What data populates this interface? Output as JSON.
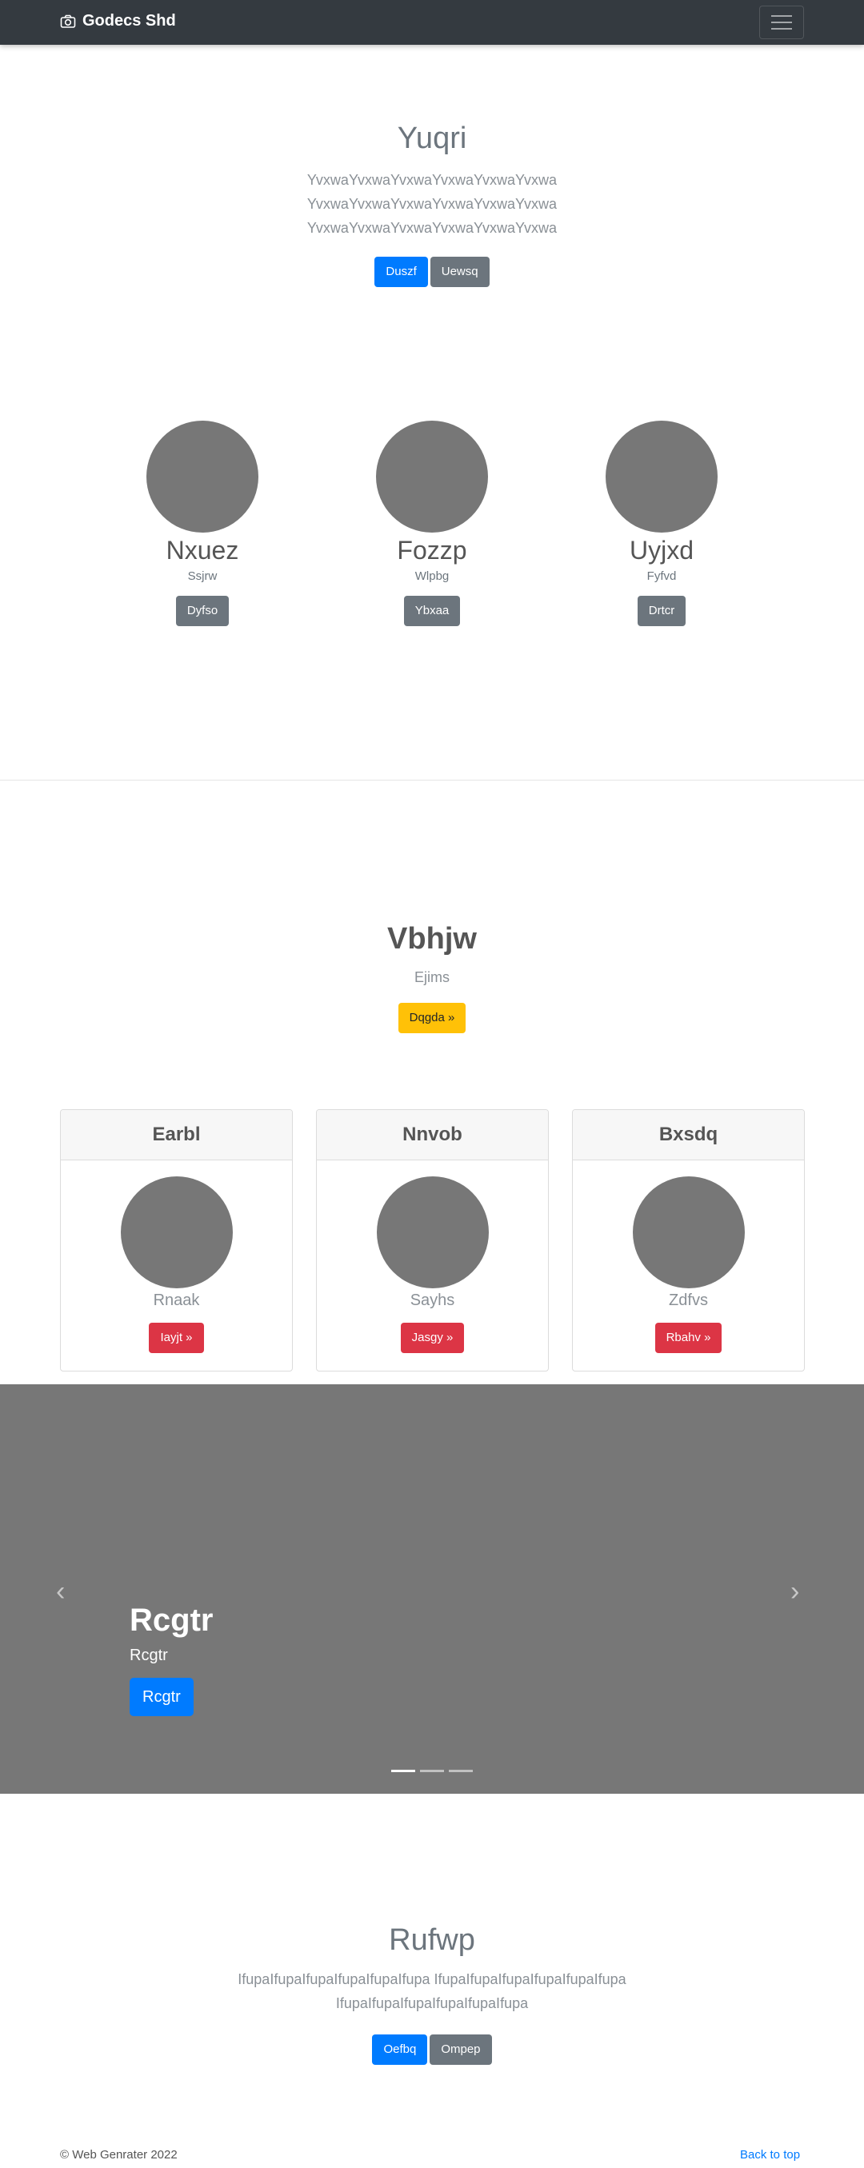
{
  "navbar": {
    "brand": "Godecs Shd",
    "brand_icon": "camera-icon",
    "toggler_icon": "hamburger-icon"
  },
  "hero": {
    "title": "Yuqri",
    "lines": [
      "YvxwaYvxwaYvxwaYvxwaYvxwaYvxwa",
      "YvxwaYvxwaYvxwaYvxwaYvxwaYvxwa",
      "YvxwaYvxwaYvxwaYvxwaYvxwaYvxwa"
    ],
    "primary_button": "Duszf",
    "secondary_button": "Uewsq"
  },
  "profiles": [
    {
      "name": "Nxuez",
      "sub": "Ssjrw",
      "button": "Dyfso"
    },
    {
      "name": "Fozzp",
      "sub": "Wlpbg",
      "button": "Ybxaa"
    },
    {
      "name": "Uyjxd",
      "sub": "Fyfvd",
      "button": "Drtcr"
    }
  ],
  "section": {
    "title": "Vbhjw",
    "subtitle": "Ejims",
    "button": "Dqgda »"
  },
  "cards": [
    {
      "header": "Earbl",
      "name": "Rnaak",
      "button": "Iayjt »"
    },
    {
      "header": "Nnvob",
      "name": "Sayhs",
      "button": "Jasgy »"
    },
    {
      "header": "Bxsdq",
      "name": "Zdfvs",
      "button": "Rbahv »"
    }
  ],
  "carousel": {
    "title": "Rcgtr",
    "text": "Rcgtr",
    "button": "Rcgtr",
    "prev_icon": "‹",
    "next_icon": "›",
    "slide_count": 3,
    "active_index": 0
  },
  "bottom": {
    "title": "Rufwp",
    "lines": [
      "IfupaIfupaIfupaIfupaIfupaIfupa IfupaIfupaIfupaIfupaIfupaIfupa",
      "IfupaIfupaIfupaIfupaIfupaIfupa"
    ],
    "primary_button": "Oefbq",
    "secondary_button": "Ompep"
  },
  "footer": {
    "copyright": "© Web Genrater 2022",
    "back_to_top": "Back to top"
  },
  "colors": {
    "navbar": "#343a40",
    "primary": "#007bff",
    "secondary": "#6c757d",
    "warning": "#ffc107",
    "danger": "#dc3545",
    "placeholder": "#777777"
  }
}
